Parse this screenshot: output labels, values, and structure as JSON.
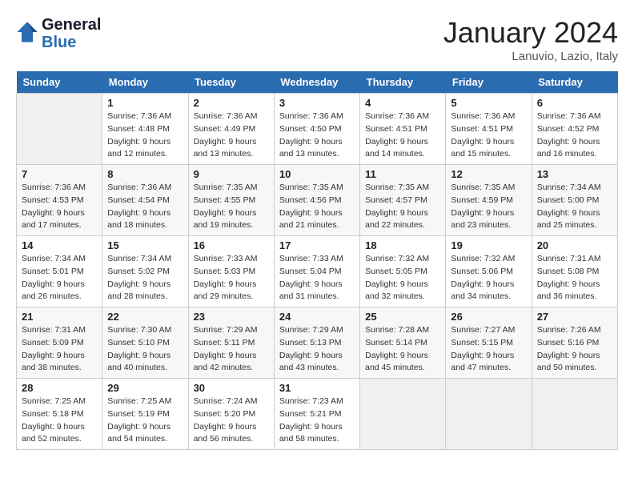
{
  "header": {
    "logo_line1": "General",
    "logo_line2": "Blue",
    "month": "January 2024",
    "location": "Lanuvio, Lazio, Italy"
  },
  "weekdays": [
    "Sunday",
    "Monday",
    "Tuesday",
    "Wednesday",
    "Thursday",
    "Friday",
    "Saturday"
  ],
  "weeks": [
    [
      {
        "day": "",
        "info": ""
      },
      {
        "day": "1",
        "info": "Sunrise: 7:36 AM\nSunset: 4:48 PM\nDaylight: 9 hours\nand 12 minutes."
      },
      {
        "day": "2",
        "info": "Sunrise: 7:36 AM\nSunset: 4:49 PM\nDaylight: 9 hours\nand 13 minutes."
      },
      {
        "day": "3",
        "info": "Sunrise: 7:36 AM\nSunset: 4:50 PM\nDaylight: 9 hours\nand 13 minutes."
      },
      {
        "day": "4",
        "info": "Sunrise: 7:36 AM\nSunset: 4:51 PM\nDaylight: 9 hours\nand 14 minutes."
      },
      {
        "day": "5",
        "info": "Sunrise: 7:36 AM\nSunset: 4:51 PM\nDaylight: 9 hours\nand 15 minutes."
      },
      {
        "day": "6",
        "info": "Sunrise: 7:36 AM\nSunset: 4:52 PM\nDaylight: 9 hours\nand 16 minutes."
      }
    ],
    [
      {
        "day": "7",
        "info": "Sunrise: 7:36 AM\nSunset: 4:53 PM\nDaylight: 9 hours\nand 17 minutes."
      },
      {
        "day": "8",
        "info": "Sunrise: 7:36 AM\nSunset: 4:54 PM\nDaylight: 9 hours\nand 18 minutes."
      },
      {
        "day": "9",
        "info": "Sunrise: 7:35 AM\nSunset: 4:55 PM\nDaylight: 9 hours\nand 19 minutes."
      },
      {
        "day": "10",
        "info": "Sunrise: 7:35 AM\nSunset: 4:56 PM\nDaylight: 9 hours\nand 21 minutes."
      },
      {
        "day": "11",
        "info": "Sunrise: 7:35 AM\nSunset: 4:57 PM\nDaylight: 9 hours\nand 22 minutes."
      },
      {
        "day": "12",
        "info": "Sunrise: 7:35 AM\nSunset: 4:59 PM\nDaylight: 9 hours\nand 23 minutes."
      },
      {
        "day": "13",
        "info": "Sunrise: 7:34 AM\nSunset: 5:00 PM\nDaylight: 9 hours\nand 25 minutes."
      }
    ],
    [
      {
        "day": "14",
        "info": "Sunrise: 7:34 AM\nSunset: 5:01 PM\nDaylight: 9 hours\nand 26 minutes."
      },
      {
        "day": "15",
        "info": "Sunrise: 7:34 AM\nSunset: 5:02 PM\nDaylight: 9 hours\nand 28 minutes."
      },
      {
        "day": "16",
        "info": "Sunrise: 7:33 AM\nSunset: 5:03 PM\nDaylight: 9 hours\nand 29 minutes."
      },
      {
        "day": "17",
        "info": "Sunrise: 7:33 AM\nSunset: 5:04 PM\nDaylight: 9 hours\nand 31 minutes."
      },
      {
        "day": "18",
        "info": "Sunrise: 7:32 AM\nSunset: 5:05 PM\nDaylight: 9 hours\nand 32 minutes."
      },
      {
        "day": "19",
        "info": "Sunrise: 7:32 AM\nSunset: 5:06 PM\nDaylight: 9 hours\nand 34 minutes."
      },
      {
        "day": "20",
        "info": "Sunrise: 7:31 AM\nSunset: 5:08 PM\nDaylight: 9 hours\nand 36 minutes."
      }
    ],
    [
      {
        "day": "21",
        "info": "Sunrise: 7:31 AM\nSunset: 5:09 PM\nDaylight: 9 hours\nand 38 minutes."
      },
      {
        "day": "22",
        "info": "Sunrise: 7:30 AM\nSunset: 5:10 PM\nDaylight: 9 hours\nand 40 minutes."
      },
      {
        "day": "23",
        "info": "Sunrise: 7:29 AM\nSunset: 5:11 PM\nDaylight: 9 hours\nand 42 minutes."
      },
      {
        "day": "24",
        "info": "Sunrise: 7:29 AM\nSunset: 5:13 PM\nDaylight: 9 hours\nand 43 minutes."
      },
      {
        "day": "25",
        "info": "Sunrise: 7:28 AM\nSunset: 5:14 PM\nDaylight: 9 hours\nand 45 minutes."
      },
      {
        "day": "26",
        "info": "Sunrise: 7:27 AM\nSunset: 5:15 PM\nDaylight: 9 hours\nand 47 minutes."
      },
      {
        "day": "27",
        "info": "Sunrise: 7:26 AM\nSunset: 5:16 PM\nDaylight: 9 hours\nand 50 minutes."
      }
    ],
    [
      {
        "day": "28",
        "info": "Sunrise: 7:25 AM\nSunset: 5:18 PM\nDaylight: 9 hours\nand 52 minutes."
      },
      {
        "day": "29",
        "info": "Sunrise: 7:25 AM\nSunset: 5:19 PM\nDaylight: 9 hours\nand 54 minutes."
      },
      {
        "day": "30",
        "info": "Sunrise: 7:24 AM\nSunset: 5:20 PM\nDaylight: 9 hours\nand 56 minutes."
      },
      {
        "day": "31",
        "info": "Sunrise: 7:23 AM\nSunset: 5:21 PM\nDaylight: 9 hours\nand 58 minutes."
      },
      {
        "day": "",
        "info": ""
      },
      {
        "day": "",
        "info": ""
      },
      {
        "day": "",
        "info": ""
      }
    ]
  ]
}
